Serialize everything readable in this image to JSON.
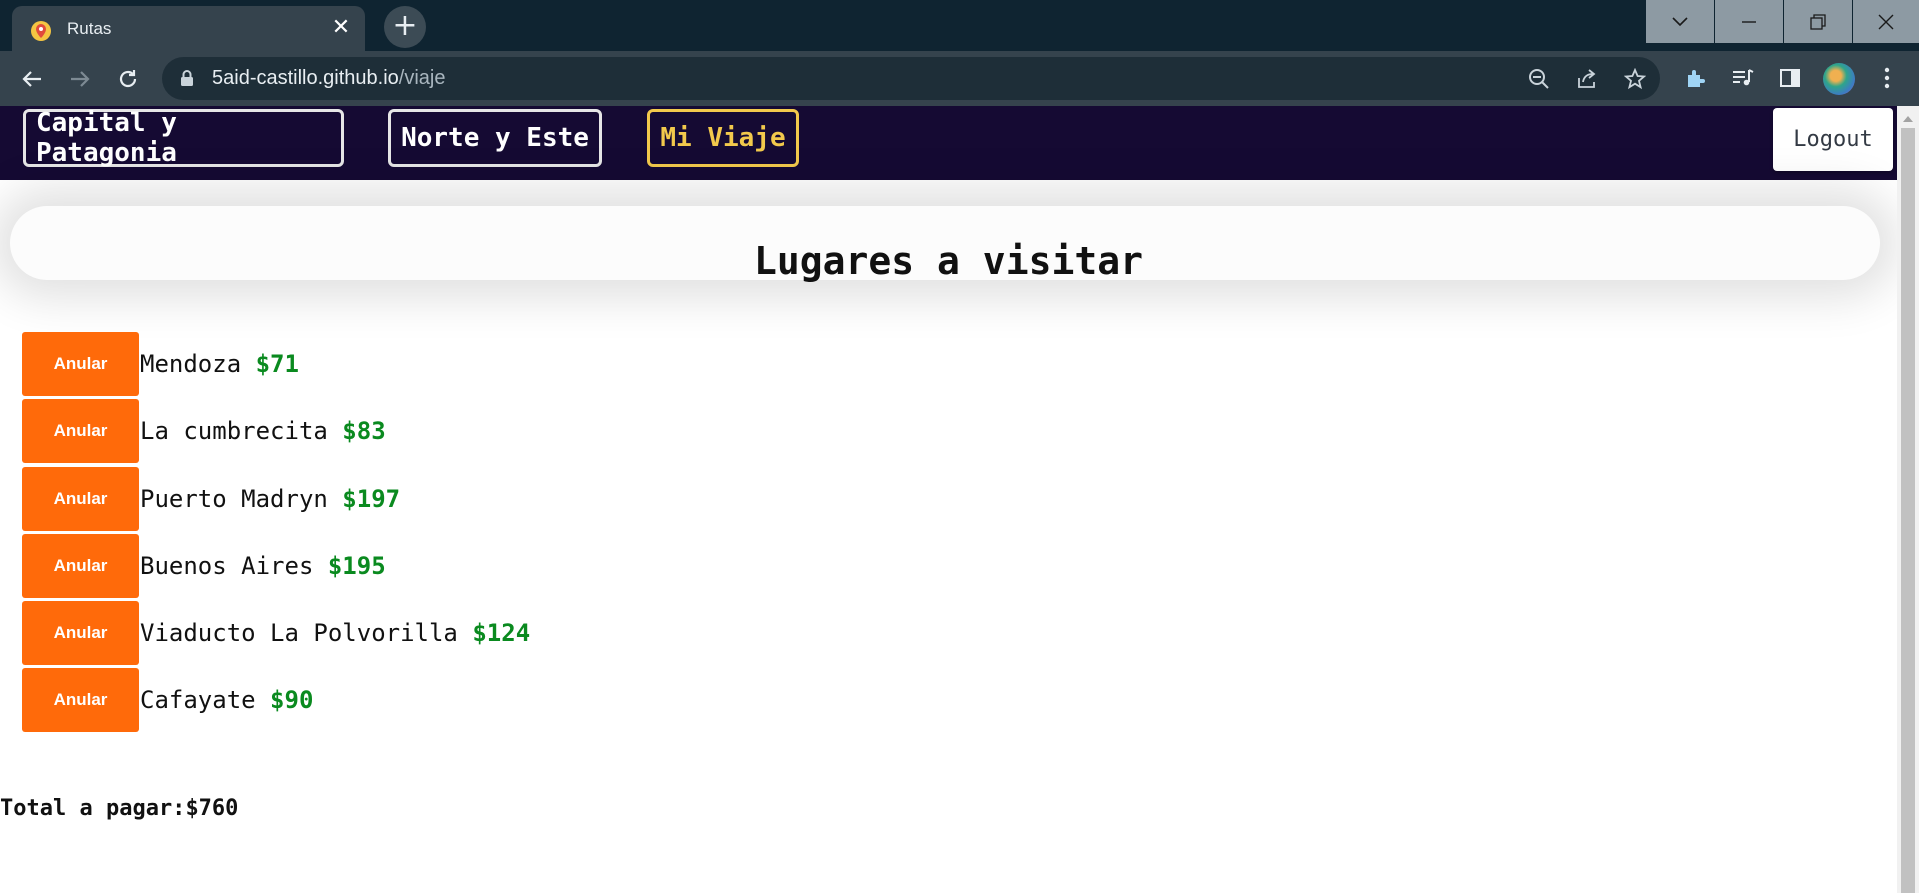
{
  "browser": {
    "tab_title": "Rutas",
    "close_glyph": "✕",
    "new_tab_glyph": "+",
    "url_domain": "5aid-castillo.github.io",
    "url_path": "/viaje"
  },
  "nav": {
    "links": [
      "Capital y Patagonia",
      "Norte y Este",
      "Mi Viaje"
    ],
    "active": "Mi Viaje",
    "logout_label": "Logout"
  },
  "main": {
    "title": "Lugares a visitar",
    "button_label": "Anular",
    "items": [
      {
        "name": "Mendoza",
        "price": "$71"
      },
      {
        "name": "La cumbrecita",
        "price": "$83"
      },
      {
        "name": "Puerto Madryn",
        "price": "$197"
      },
      {
        "name": "Buenos Aires",
        "price": "$195"
      },
      {
        "name": "Viaducto La Polvorilla",
        "price": "$124"
      },
      {
        "name": "Cafayate",
        "price": "$90"
      }
    ],
    "total_label": "Total a pagar:",
    "total_value": "$760"
  },
  "colors": {
    "navbar_bg": "#150a33",
    "active_link": "#f2c94c",
    "anular_button": "#ff6a0a",
    "price_green": "#0a8a1f"
  },
  "icons": [
    "maps-favicon-icon",
    "chevron-down-icon",
    "minimize-icon",
    "restore-icon",
    "window-close-icon",
    "back-arrow-icon",
    "forward-arrow-icon",
    "reload-icon",
    "lock-icon",
    "zoom-out-icon",
    "share-icon",
    "star-icon",
    "extensions-icon",
    "media-queue-icon",
    "side-panel-icon",
    "profile-avatar-icon",
    "more-vert-icon"
  ]
}
